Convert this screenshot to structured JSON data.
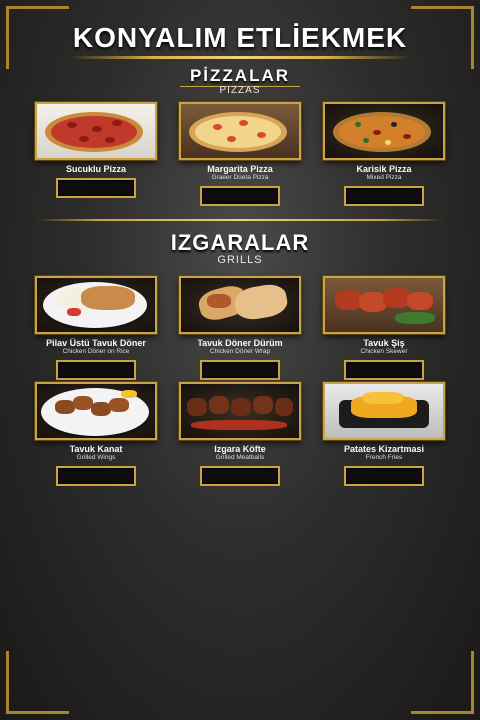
{
  "header": {
    "title": "KONYALIM ETLİEKMEK"
  },
  "sections": {
    "pizzas": {
      "title": "PİZZALAR",
      "subtitle": "PIZZAS",
      "items": [
        {
          "name": "Sucuklu Pizza",
          "sub": ""
        },
        {
          "name": "Margarita Pizza",
          "sub": "Graeer Düeta Pizza"
        },
        {
          "name": "Karisik Pizza",
          "sub": "Mixed Pizza"
        }
      ]
    },
    "grills": {
      "title": "IZGARALAR",
      "subtitle": "GRILLS",
      "items": [
        {
          "name": "Pilav Üstü Tavuk Döner",
          "sub": "Chicken Döner on Rice"
        },
        {
          "name": "Tavuk Döner Dürüm",
          "sub": "Chicken Döner Wrap"
        },
        {
          "name": "Tavuk Şiş",
          "sub": "Chicken Skewer"
        },
        {
          "name": "Tavuk Kanat",
          "sub": "Grilled Wings"
        },
        {
          "name": "Izgara Köfte",
          "sub": "Grilled Meatballs"
        },
        {
          "name": "Patates Kizartmasi",
          "sub": "French Fries"
        }
      ]
    }
  },
  "colors": {
    "gold": "#caa443",
    "background": "#2e2d2b"
  }
}
